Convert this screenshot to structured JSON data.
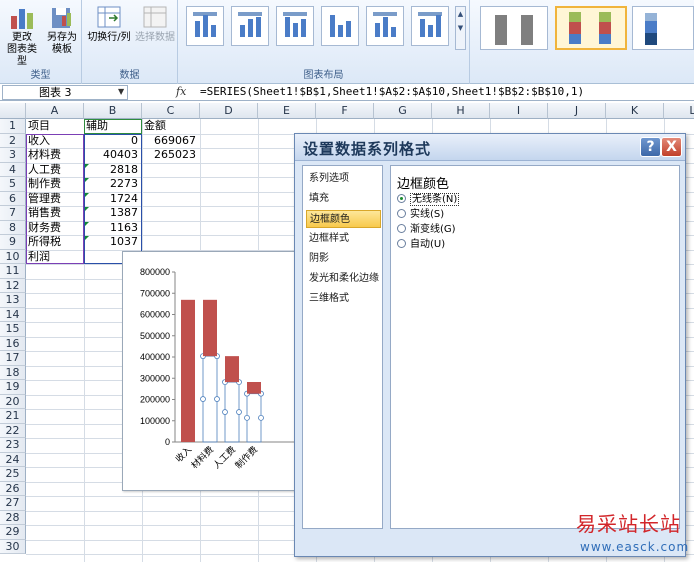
{
  "ribbon": {
    "groups": [
      {
        "label": "类型",
        "buttons": [
          {
            "label1": "更改",
            "label2": "图表类型"
          },
          {
            "label1": "另存为",
            "label2": "模板"
          }
        ]
      },
      {
        "label": "数据",
        "buttons": [
          {
            "label1": "切换行/列",
            "label2": ""
          },
          {
            "label1": "选择数据",
            "label2": ""
          }
        ]
      },
      {
        "label": "图表布局"
      }
    ],
    "colors": {
      "bar_blue": "#4a7cc7",
      "bar_red": "#c0504d",
      "bar_green": "#9bbb59",
      "bar_gray": "#7f7f7f"
    }
  },
  "formula_bar": {
    "name_box": "图表 3",
    "fx": "fx",
    "formula": "=SERIES(Sheet1!$B$1,Sheet1!$A$2:$A$10,Sheet1!$B$2:$B$10,1)"
  },
  "sheet": {
    "columns": [
      "A",
      "B",
      "C",
      "D",
      "E",
      "F",
      "G",
      "H",
      "I",
      "J",
      "K",
      "L"
    ],
    "rows": [
      "1",
      "2",
      "3",
      "4",
      "5",
      "6",
      "7",
      "8",
      "9",
      "10",
      "11",
      "12",
      "13",
      "14",
      "15",
      "16",
      "17",
      "18",
      "19",
      "20",
      "21",
      "22",
      "23",
      "24",
      "25",
      "26",
      "27",
      "28",
      "29",
      "30"
    ],
    "col_a": [
      "项目",
      "收入",
      "材料费",
      "人工费",
      "制作费",
      "管理费",
      "销售费",
      "财务费",
      "所得税",
      "利润"
    ],
    "col_b": [
      "辅助",
      "0",
      "40403",
      "2818",
      "2273",
      "1724",
      "1387",
      "1163",
      "1037",
      ""
    ],
    "col_c": [
      "金额",
      "669067",
      "265023"
    ]
  },
  "chart_data": {
    "type": "bar",
    "categories": [
      "收入",
      "材料费",
      "人工费",
      "制作费"
    ],
    "series": [
      {
        "values": [
          0,
          404044,
          281842,
          227330
        ]
      },
      {
        "values": [
          669067,
          265023,
          122202,
          55000
        ]
      }
    ],
    "y_ticks": [
      "800000",
      "700000",
      "600000",
      "500000",
      "400000",
      "300000",
      "200000",
      "100000",
      "0"
    ],
    "ylim": [
      0,
      800000
    ],
    "stacked": true,
    "colors": {
      "series2": "#c0504d",
      "series1_marker": "#4f81bd"
    }
  },
  "dialog": {
    "title": "设置数据系列格式",
    "help_label": "?",
    "close_label": "X",
    "nav": [
      "系列选项",
      "填充",
      "边框颜色",
      "边框样式",
      "阴影",
      "发光和柔化边缘",
      "三维格式"
    ],
    "selected_nav": "边框颜色",
    "heading": "边框颜色",
    "options": [
      "无线条(N)",
      "实线(S)",
      "渐变线(G)",
      "自动(U)"
    ],
    "selected_option": "无线条(N)"
  },
  "watermark": {
    "title": "易采站长站",
    "url": "www.easck.com"
  }
}
